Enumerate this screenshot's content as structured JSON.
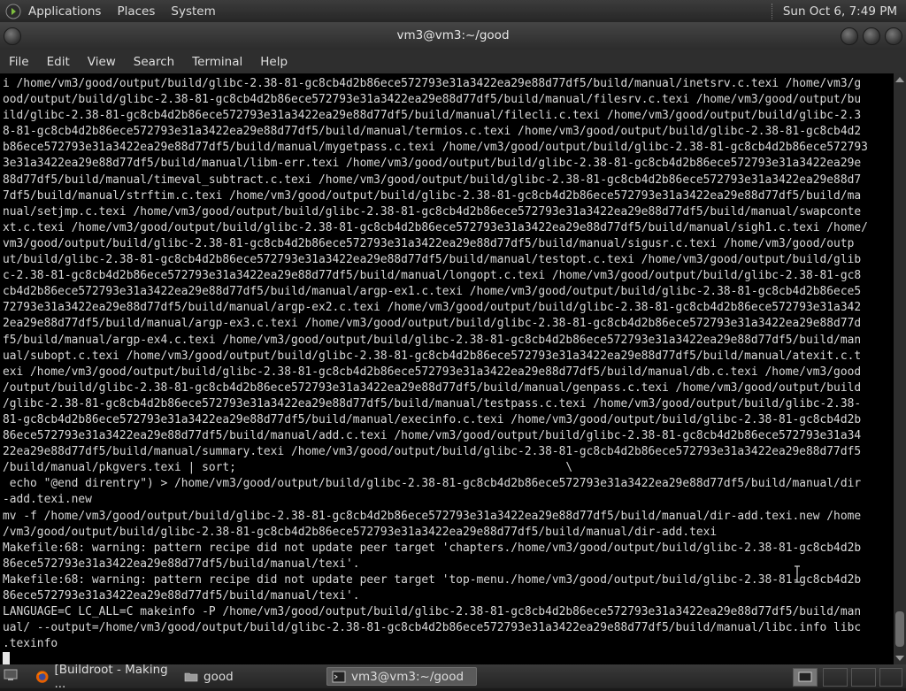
{
  "top_panel": {
    "menus": [
      "Applications",
      "Places",
      "System"
    ],
    "clock": "Sun Oct  6,  7:49 PM"
  },
  "window": {
    "title": "vm3@vm3:~/good"
  },
  "menubar": [
    "File",
    "Edit",
    "View",
    "Search",
    "Terminal",
    "Help"
  ],
  "terminal": {
    "lines": [
      "i /home/vm3/good/output/build/glibc-2.38-81-gc8cb4d2b86ece572793e31a3422ea29e88d77df5/build/manual/inetsrv.c.texi /home/vm3/g",
      "ood/output/build/glibc-2.38-81-gc8cb4d2b86ece572793e31a3422ea29e88d77df5/build/manual/filesrv.c.texi /home/vm3/good/output/bu",
      "ild/glibc-2.38-81-gc8cb4d2b86ece572793e31a3422ea29e88d77df5/build/manual/filecli.c.texi /home/vm3/good/output/build/glibc-2.3",
      "8-81-gc8cb4d2b86ece572793e31a3422ea29e88d77df5/build/manual/termios.c.texi /home/vm3/good/output/build/glibc-2.38-81-gc8cb4d2",
      "b86ece572793e31a3422ea29e88d77df5/build/manual/mygetpass.c.texi /home/vm3/good/output/build/glibc-2.38-81-gc8cb4d2b86ece572793",
      "3e31a3422ea29e88d77df5/build/manual/libm-err.texi /home/vm3/good/output/build/glibc-2.38-81-gc8cb4d2b86ece572793e31a3422ea29e",
      "88d77df5/build/manual/timeval_subtract.c.texi /home/vm3/good/output/build/glibc-2.38-81-gc8cb4d2b86ece572793e31a3422ea29e88d7",
      "7df5/build/manual/strftim.c.texi /home/vm3/good/output/build/glibc-2.38-81-gc8cb4d2b86ece572793e31a3422ea29e88d77df5/build/ma",
      "nual/setjmp.c.texi /home/vm3/good/output/build/glibc-2.38-81-gc8cb4d2b86ece572793e31a3422ea29e88d77df5/build/manual/swapconte",
      "xt.c.texi /home/vm3/good/output/build/glibc-2.38-81-gc8cb4d2b86ece572793e31a3422ea29e88d77df5/build/manual/sigh1.c.texi /home/",
      "vm3/good/output/build/glibc-2.38-81-gc8cb4d2b86ece572793e31a3422ea29e88d77df5/build/manual/sigusr.c.texi /home/vm3/good/outp",
      "ut/build/glibc-2.38-81-gc8cb4d2b86ece572793e31a3422ea29e88d77df5/build/manual/testopt.c.texi /home/vm3/good/output/build/glib",
      "c-2.38-81-gc8cb4d2b86ece572793e31a3422ea29e88d77df5/build/manual/longopt.c.texi /home/vm3/good/output/build/glibc-2.38-81-gc8",
      "cb4d2b86ece572793e31a3422ea29e88d77df5/build/manual/argp-ex1.c.texi /home/vm3/good/output/build/glibc-2.38-81-gc8cb4d2b86ece5",
      "72793e31a3422ea29e88d77df5/build/manual/argp-ex2.c.texi /home/vm3/good/output/build/glibc-2.38-81-gc8cb4d2b86ece572793e31a342",
      "2ea29e88d77df5/build/manual/argp-ex3.c.texi /home/vm3/good/output/build/glibc-2.38-81-gc8cb4d2b86ece572793e31a3422ea29e88d77d",
      "f5/build/manual/argp-ex4.c.texi /home/vm3/good/output/build/glibc-2.38-81-gc8cb4d2b86ece572793e31a3422ea29e88d77df5/build/man",
      "ual/subopt.c.texi /home/vm3/good/output/build/glibc-2.38-81-gc8cb4d2b86ece572793e31a3422ea29e88d77df5/build/manual/atexit.c.t",
      "exi /home/vm3/good/output/build/glibc-2.38-81-gc8cb4d2b86ece572793e31a3422ea29e88d77df5/build/manual/db.c.texi /home/vm3/good",
      "/output/build/glibc-2.38-81-gc8cb4d2b86ece572793e31a3422ea29e88d77df5/build/manual/genpass.c.texi /home/vm3/good/output/build",
      "/glibc-2.38-81-gc8cb4d2b86ece572793e31a3422ea29e88d77df5/build/manual/testpass.c.texi /home/vm3/good/output/build/glibc-2.38-",
      "81-gc8cb4d2b86ece572793e31a3422ea29e88d77df5/build/manual/execinfo.c.texi /home/vm3/good/output/build/glibc-2.38-81-gc8cb4d2b",
      "86ece572793e31a3422ea29e88d77df5/build/manual/add.c.texi /home/vm3/good/output/build/glibc-2.38-81-gc8cb4d2b86ece572793e31a34",
      "22ea29e88d77df5/build/manual/summary.texi /home/vm3/good/output/build/glibc-2.38-81-gc8cb4d2b86ece572793e31a3422ea29e88d77df5",
      "/build/manual/pkgvers.texi | sort;                                                \\",
      " echo \"@end direntry\") > /home/vm3/good/output/build/glibc-2.38-81-gc8cb4d2b86ece572793e31a3422ea29e88d77df5/build/manual/dir",
      "-add.texi.new",
      "mv -f /home/vm3/good/output/build/glibc-2.38-81-gc8cb4d2b86ece572793e31a3422ea29e88d77df5/build/manual/dir-add.texi.new /home",
      "/vm3/good/output/build/glibc-2.38-81-gc8cb4d2b86ece572793e31a3422ea29e88d77df5/build/manual/dir-add.texi",
      "Makefile:68: warning: pattern recipe did not update peer target 'chapters./home/vm3/good/output/build/glibc-2.38-81-gc8cb4d2b",
      "86ece572793e31a3422ea29e88d77df5/build/manual/texi'.",
      "Makefile:68: warning: pattern recipe did not update peer target 'top-menu./home/vm3/good/output/build/glibc-2.38-81-gc8cb4d2b",
      "86ece572793e31a3422ea29e88d77df5/build/manual/texi'.",
      "LANGUAGE=C LC_ALL=C makeinfo -P /home/vm3/good/output/build/glibc-2.38-81-gc8cb4d2b86ece572793e31a3422ea29e88d77df5/build/man",
      "ual/ --output=/home/vm3/good/output/build/glibc-2.38-81-gc8cb4d2b86ece572793e31a3422ea29e88d77df5/build/manual/libc.info libc",
      ".texinfo",
      ""
    ]
  },
  "taskbar": {
    "tasks": [
      {
        "label": "[Buildroot - Making ...",
        "icon": "firefox-icon"
      },
      {
        "label": "good",
        "icon": "folder-icon"
      },
      {
        "label": "vm3@vm3:~/good",
        "icon": "terminal-icon"
      }
    ]
  }
}
